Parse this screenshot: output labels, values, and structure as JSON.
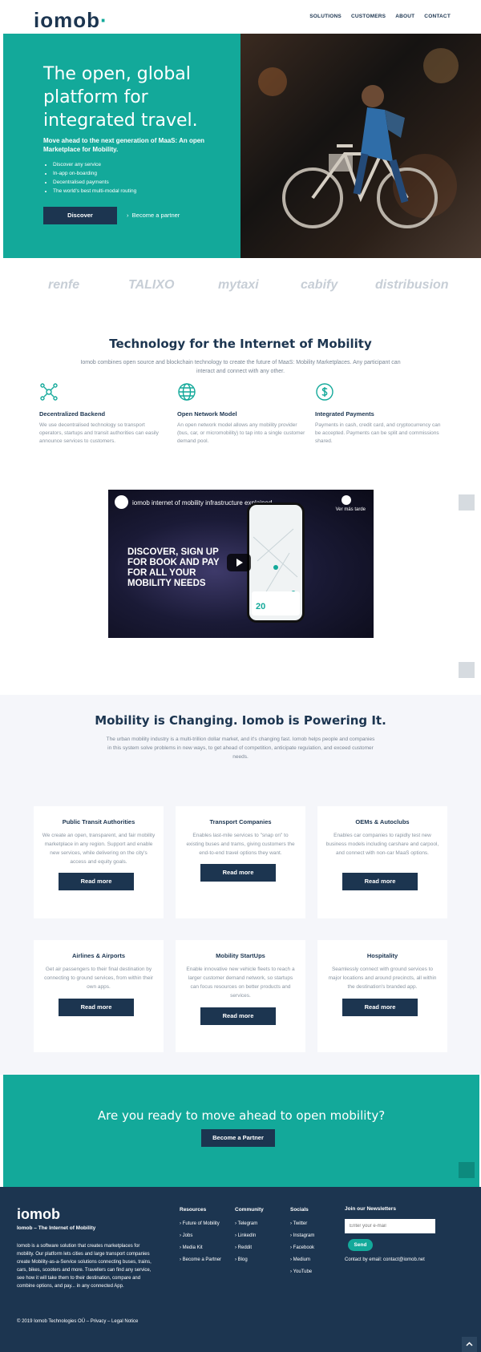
{
  "header": {
    "logo": "iomob",
    "nav": [
      "SOLUTIONS",
      "CUSTOMERS",
      "ABOUT",
      "CONTACT"
    ]
  },
  "hero": {
    "title": "The open, global platform for integrated travel.",
    "subtitle": "Move ahead to the next generation of MaaS: An open Marketplace for Mobility.",
    "bullets": [
      "Discover any service",
      "In-app on-boarding",
      "Decentralised payments",
      "The world's best multi-modal routing"
    ],
    "discover_label": "Discover",
    "partner_label": "Become a partner"
  },
  "partners": [
    "renfe",
    "TALIXO",
    "mytaxi",
    "cabify",
    "distribusion"
  ],
  "tech": {
    "title": "Technology for the Internet of Mobility",
    "subtitle": "Iomob combines open source and blockchain technology to create the future of MaaS: Mobility Marketplaces. Any participant can interact and connect with any other.",
    "features": [
      {
        "title": "Decentralized Backend",
        "text": "We use decentralised technology so transport operators, startups and transit authorities can easily announce services to customers.",
        "icon": "network-icon"
      },
      {
        "title": "Open Network Model",
        "text": "An open network model allows any mobility provider (bus, car, or micromobility) to tap into a single customer demand pool.",
        "icon": "globe-icon"
      },
      {
        "title": "Integrated Payments",
        "text": "Payments in cash, credit card, and cryptocurrency can be accepted. Payments can be split and commissions shared.",
        "icon": "dollar-icon"
      }
    ]
  },
  "video": {
    "title": "iomob internet of mobility infrastructure explained",
    "watch_label": "Ver más tarde",
    "headline": "DISCOVER, SIGN UP FOR BOOK AND PAY FOR ALL YOUR MOBILITY NEEDS",
    "avatar_label": "iomob"
  },
  "mobility": {
    "title": "Mobility is Changing. Iomob is Powering It.",
    "subtitle": "The urban mobility industry is a multi-trillion dollar market, and it's changing fast. Iomob helps people and companies in this system solve problems in new ways, to get ahead of competition, anticipate regulation, and exceed customer needs.",
    "read_more": "Read more",
    "cards": [
      {
        "title": "Public Transit Authorities",
        "text": "We create an open, transparent, and fair mobility marketplace in any region. Support and enable new services, while delivering on the city's access and equity goals."
      },
      {
        "title": "Transport Companies",
        "text": "Enables last-mile services to \"snap on\" to existing buses and trams, giving customers the end-to-end travel options they want."
      },
      {
        "title": "OEMs & Autoclubs",
        "text": "Enables car companies to rapidly test new business models including carshare and carpool, and connect with non-car MaaS options."
      },
      {
        "title": "Airlines & Airports",
        "text": "Get air passengers to their final destination by connecting to ground services, from within their own apps."
      },
      {
        "title": "Mobility StartUps",
        "text": "Enable innovative new vehicle fleets to reach a larger customer demand network, so startups can focus resources on better products and services."
      },
      {
        "title": "Hospitality",
        "text": "Seamlessly connect with ground services to major locations and around precincts, all within the destination's branded app."
      }
    ]
  },
  "cta": {
    "title": "Are you ready to move ahead to open mobility?",
    "button": "Become a Partner"
  },
  "footer": {
    "logo": "iomob",
    "tagline": "Iomob – The Internet of Mobility",
    "description": "Iomob is a software solution that creates marketplaces for mobility. Our platform lets cities and large transport companies create Mobility-as-a-Service solutions connecting buses, trains, cars, bikes, scooters and more. Travellers can find any service, see how it will take them to their destination, compare and combine options, and pay... in any connected App.",
    "columns": [
      {
        "title": "Resources",
        "items": [
          "Future of Mobility",
          "Jobs",
          "Media Kit",
          "Become a Partner"
        ]
      },
      {
        "title": "Community",
        "items": [
          "Telegram",
          "LinkedIn",
          "Reddit",
          "Blog"
        ]
      },
      {
        "title": "Socials",
        "items": [
          "Twitter",
          "Instagram",
          "Facebook",
          "Medium",
          "YouTube"
        ]
      }
    ],
    "newsletter_title": "Join our Newsletters",
    "email_placeholder": "Enter your e-mail",
    "send_label": "Send",
    "contact": "Contact by email: contact@iomob.net",
    "copyright": "© 2019 Iomob Technologies OÜ – Privacy – Legal Notice"
  },
  "colors": {
    "teal": "#13a99a",
    "navy": "#1c3550",
    "light_bg": "#f5f6fa"
  }
}
